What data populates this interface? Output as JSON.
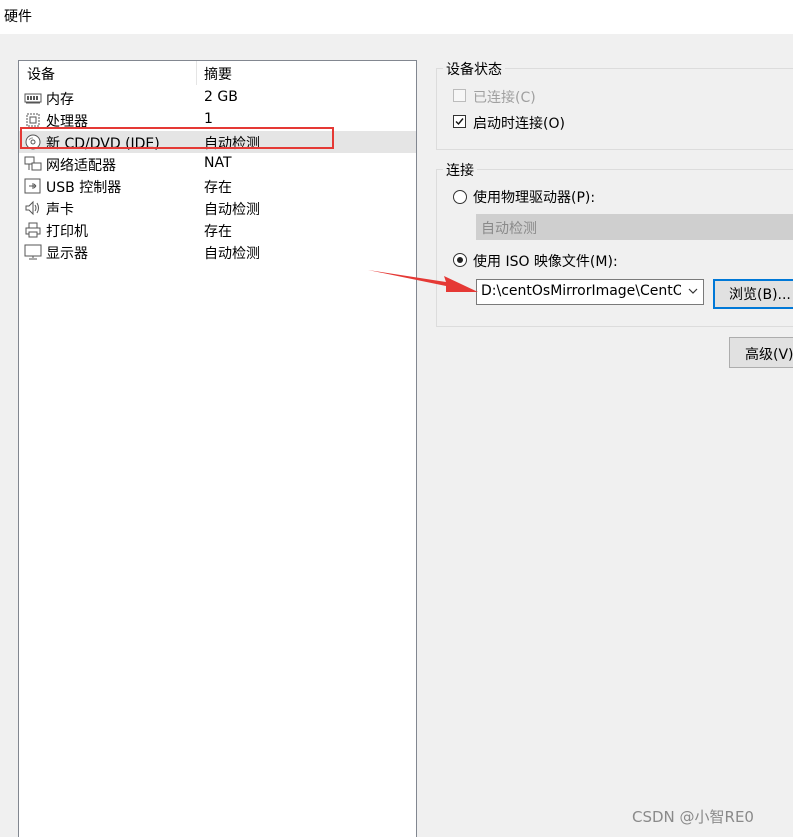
{
  "title": "硬件",
  "device_list": {
    "headers": [
      "设备",
      "摘要"
    ],
    "rows": [
      {
        "icon": "memory-icon",
        "device": "内存",
        "summary": "2 GB"
      },
      {
        "icon": "processor-icon",
        "device": "处理器",
        "summary": "1"
      },
      {
        "icon": "cd-dvd-icon",
        "device": "新 CD/DVD (IDE)",
        "summary": "自动检测",
        "selected": true
      },
      {
        "icon": "network-adapter-icon",
        "device": "网络适配器",
        "summary": "NAT"
      },
      {
        "icon": "usb-icon",
        "device": "USB 控制器",
        "summary": "存在"
      },
      {
        "icon": "sound-card-icon",
        "device": "声卡",
        "summary": "自动检测"
      },
      {
        "icon": "printer-icon",
        "device": "打印机",
        "summary": "存在"
      },
      {
        "icon": "display-icon",
        "device": "显示器",
        "summary": "自动检测"
      }
    ]
  },
  "device_status": {
    "label": "设备状态",
    "connected": {
      "label": "已连接(C)",
      "checked": false,
      "disabled": true
    },
    "connect_at_power_on": {
      "label": "启动时连接(O)",
      "checked": true
    }
  },
  "connection": {
    "label": "连接",
    "physical_drive": {
      "label": "使用物理驱动器(P):",
      "selected": false
    },
    "physical_drive_value": "自动检测",
    "iso_image": {
      "label": "使用 ISO 映像文件(M):",
      "selected": true
    },
    "iso_path": "D:\\centOsMirrorImage\\CentOS",
    "browse_label": "浏览(B)..."
  },
  "advanced_label": "高级(V)",
  "watermark": "CSDN @小智RE0",
  "colors": {
    "highlight_box": "#e53935",
    "arrow": "#e53935"
  }
}
